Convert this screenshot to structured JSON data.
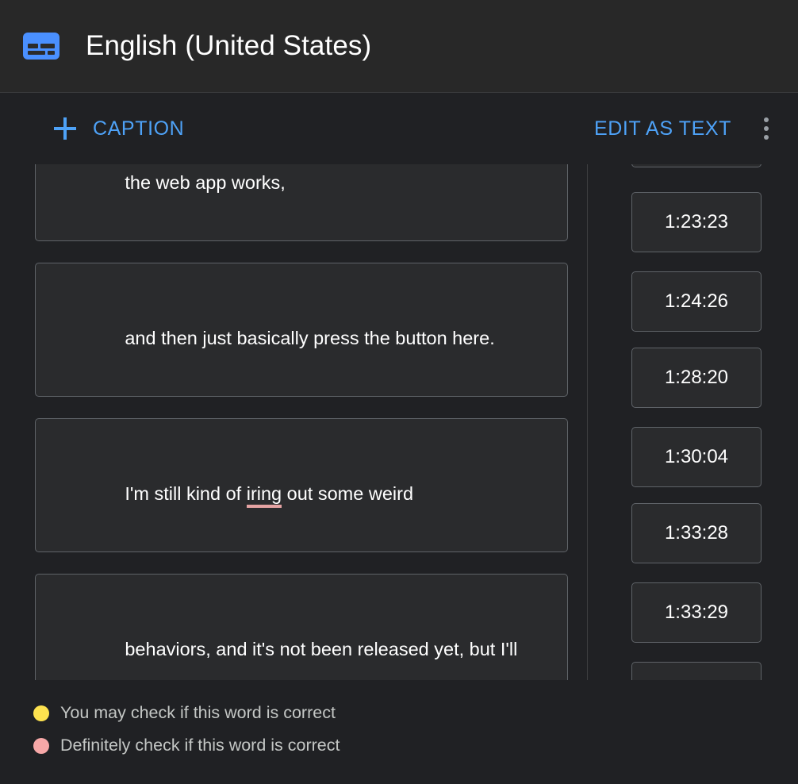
{
  "header": {
    "icon": "closed-caption-icon",
    "title": "English (United States)"
  },
  "toolbar": {
    "add_caption_icon": "plus-icon",
    "add_caption_label": "CAPTION",
    "edit_as_text_label": "EDIT AS TEXT",
    "overflow_icon": "more-vert-icon"
  },
  "captions": [
    {
      "text_before": "the web app works,",
      "misspelled": "",
      "text_after": "",
      "timestamp": ""
    },
    {
      "text_before": "and then just basically press the button here.",
      "misspelled": "",
      "text_after": "",
      "timestamp": "1:23:23"
    },
    {
      "text_before": "I'm still kind of ",
      "misspelled": "iring",
      "text_after": " out some weird",
      "timestamp": "1:24:26"
    },
    {
      "text_before": "behaviors, and it's not been released yet, but I'll",
      "misspelled": "",
      "text_after": "",
      "timestamp": "1:28:20"
    }
  ],
  "timestamps": [
    "1:23:23",
    "1:24:26",
    "1:28:20",
    "1:30:04",
    "1:33:28",
    "1:33:29"
  ],
  "legend": {
    "items": [
      {
        "color": "#fde24f",
        "label": "You may check if this word is correct"
      },
      {
        "color": "#f7a8a8",
        "label": "Definitely check if this word is correct"
      }
    ]
  },
  "colors": {
    "accent": "#4ea2f7",
    "background": "#202124",
    "header_background": "#282828",
    "card_border": "#5f6368",
    "warn": "#fde24f",
    "error": "#f7a8a8"
  }
}
